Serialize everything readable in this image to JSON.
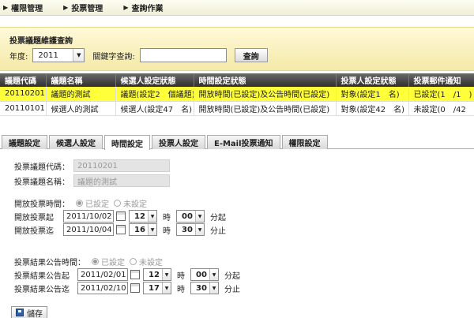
{
  "breadcrumb": [
    "權限管理",
    "投票管理",
    "查詢作業"
  ],
  "search": {
    "title": "投票議題維護查詢",
    "year_label": "年度:",
    "year_value": "2011",
    "keyword_label": "關鍵字查詢:",
    "keyword_value": "",
    "button_label": "查詢"
  },
  "table": {
    "headers": [
      "議題代碼",
      "議題名稱",
      "候選人設定狀態",
      "時間設定狀態",
      "投票人設定狀態",
      "投票郵件通知"
    ],
    "rows": [
      [
        "20110201",
        "議題的測試",
        "議題(設定2　個議題)",
        "開放時間(已設定)及公告時間(已設定)",
        "對象(設定1　名)",
        "已設定(1　/1　)"
      ],
      [
        "20110101",
        "候選人的測試",
        "候選人(設定47　名)",
        "開放時間(已設定)及公告時間(已設定)",
        "對象(設定42　名)",
        "未設定(0　/42"
      ]
    ]
  },
  "tabs": [
    "議題設定",
    "候選人設定",
    "時間設定",
    "投票人設定",
    "E-Mail投票通知",
    "權限設定"
  ],
  "form": {
    "code_label": "投票議題代碼：",
    "code_value": "20110201",
    "name_label": "投票議題名稱：",
    "name_value": "議題的測試",
    "open_label": "開放投票時間：",
    "set_label": "已設定",
    "unset_label": "未設定",
    "open_start_label": "開放投票起",
    "open_start_date": "2011/10/02",
    "open_start_hour": "12",
    "open_start_min": "00",
    "open_start_suffix": "分起",
    "open_end_label": "開放投票迄",
    "open_end_date": "2011/10/04",
    "open_end_hour": "16",
    "open_end_min": "30",
    "open_end_suffix": "分止",
    "hour_unit": "時",
    "result_label": "投票結果公告時間：",
    "result_start_label": "投票結果公告起",
    "result_start_date": "2011/02/01",
    "result_start_hour": "12",
    "result_start_min": "00",
    "result_start_suffix": "分起",
    "result_end_label": "投票結果公告迄",
    "result_end_date": "2011/02/10",
    "result_end_hour": "17",
    "result_end_min": "30",
    "result_end_suffix": "分止",
    "save_label": "儲存"
  },
  "colors": {
    "selected_row": "#ffff3a",
    "header_bg": "#3a3a3a",
    "search_bg": "#f7eeb8"
  }
}
